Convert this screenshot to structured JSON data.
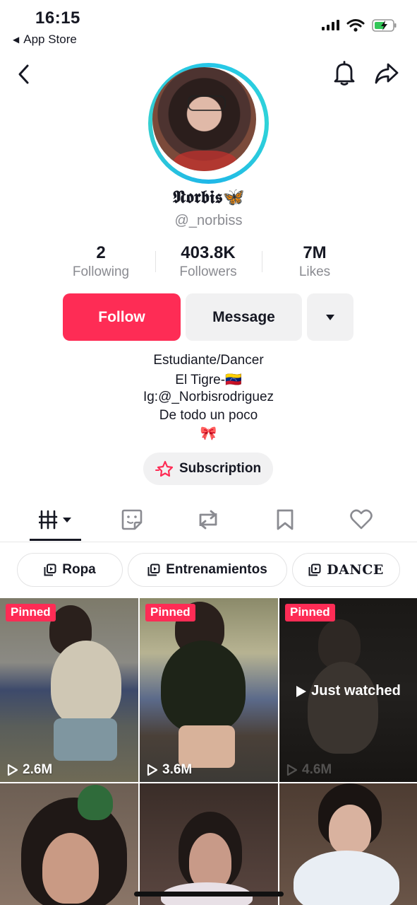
{
  "status_bar": {
    "time": "16:15",
    "back_app": "App Store"
  },
  "profile": {
    "display_name": "𝕹𝖔𝖗𝖇𝖎𝖘🦋",
    "handle": "@_norbiss",
    "stats": [
      {
        "value": "2",
        "label": "Following"
      },
      {
        "value": "403.8K",
        "label": "Followers"
      },
      {
        "value": "7M",
        "label": "Likes"
      }
    ],
    "buttons": {
      "follow": "Follow",
      "message": "Message"
    },
    "bio": [
      "Estudiante/Dancer",
      "El Tigre-🇻🇪",
      "Ig:@_Norbisrodriguez",
      "De todo un poco",
      "🎀"
    ],
    "subscription_label": "Subscription"
  },
  "tabs": [
    "videos-icon",
    "sticker-icon",
    "repost-icon",
    "bookmark-icon",
    "heart-icon"
  ],
  "playlists": [
    "Ropa",
    "Entrenamientos",
    "DANCE"
  ],
  "videos": [
    {
      "pinned": "Pinned",
      "views": "2.6M"
    },
    {
      "pinned": "Pinned",
      "views": "3.6M"
    },
    {
      "pinned": "Pinned",
      "views": "4.6M",
      "overlay": "Just watched"
    },
    {},
    {},
    {}
  ],
  "colors": {
    "accent": "#fe2c55",
    "ring": "#25c6e8",
    "text": "#161823",
    "muted": "#8a8b91"
  }
}
